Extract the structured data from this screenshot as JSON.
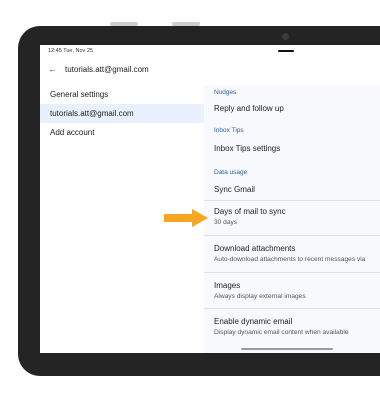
{
  "status": {
    "time_date": "12:45  Tue, Nov 25"
  },
  "appbar": {
    "title": "tutorials.att@gmail.com"
  },
  "left_nav": {
    "items": [
      {
        "label": "General settings"
      },
      {
        "label": "tutorials.att@gmail.com"
      },
      {
        "label": "Add account"
      }
    ]
  },
  "settings": {
    "nudges_header": "Nudges",
    "reply_follow": "Reply and follow up",
    "inbox_tips_header": "Inbox Tips",
    "inbox_tips": "Inbox Tips settings",
    "data_usage_header": "Data usage",
    "sync_gmail": "Sync Gmail",
    "days_sync": {
      "title": "Days of mail to sync",
      "sub": "30 days"
    },
    "download": {
      "title": "Download attachments",
      "sub": "Auto-download attachments to recent messages via"
    },
    "images": {
      "title": "Images",
      "sub": "Always display external images"
    },
    "dynamic": {
      "title": "Enable dynamic email",
      "sub": "Display dynamic email content when available"
    }
  },
  "colors": {
    "arrow": "#f5a623",
    "section_header": "#2f5fa8",
    "selected_nav": "#e8f0fd"
  }
}
